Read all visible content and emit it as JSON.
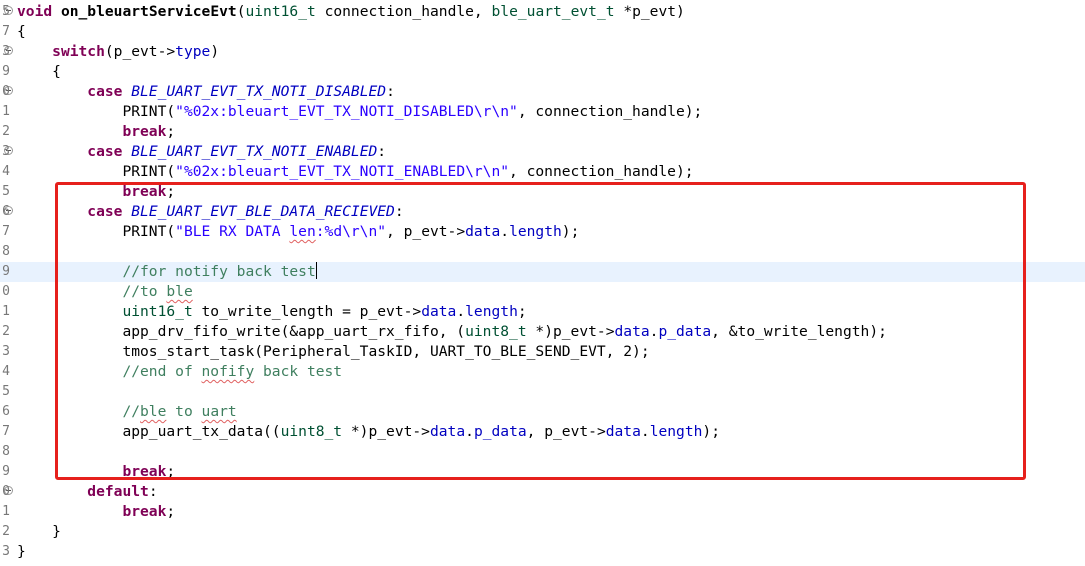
{
  "gutter_numbers": [
    "5",
    "7",
    "3",
    "9",
    "0",
    "1",
    "2",
    "3",
    "4",
    "5",
    "6",
    "7",
    "8",
    "9",
    "0",
    "1",
    "2",
    "3",
    "4",
    "5",
    "6",
    "7",
    "8",
    "9",
    "0",
    "1",
    "2",
    "3"
  ],
  "code": {
    "l0": {
      "kw": "void",
      "fn": "on_bleuartServiceEvt",
      "p1": "(",
      "t1": "uint16_t",
      "p2": " connection_handle, ",
      "t2": "ble_uart_evt_t",
      "p3": " *p_evt)"
    },
    "l1": {
      "text": "{"
    },
    "l2": {
      "kw": "switch",
      "p1": "(p_evt->",
      "fld": "type",
      "p2": ")"
    },
    "l3": {
      "text": "{"
    },
    "l4": {
      "kw": "case",
      "en": "BLE_UART_EVT_TX_NOTI_DISABLED",
      "p": ":"
    },
    "l5": {
      "p1": "PRINT(",
      "str": "\"%02x:bleuart_EVT_TX_NOTI_DISABLED\\r\\n\"",
      "p2": ", connection_handle);"
    },
    "l6": {
      "kw": "break",
      "p": ";"
    },
    "l7": {
      "kw": "case",
      "en": "BLE_UART_EVT_TX_NOTI_ENABLED",
      "p": ":"
    },
    "l8": {
      "p1": "PRINT(",
      "str": "\"%02x:bleuart_EVT_TX_NOTI_ENABLED\\r\\n\"",
      "p2": ", connection_handle);"
    },
    "l9": {
      "kw": "break",
      "p": ";"
    },
    "l10": {
      "kw": "case",
      "en": "BLE_UART_EVT_BLE_DATA_RECIEVED",
      "p": ":"
    },
    "l11": {
      "p1": "PRINT(",
      "s1": "\"BLE RX DATA ",
      "s2": "len",
      "s3": ":%d\\r\\n\"",
      "p2": ", p_evt->",
      "f1": "data",
      "p3": ".",
      "f2": "length",
      "p4": ");"
    },
    "l12": {
      "text": ""
    },
    "l13": {
      "cm": "//for notify back test"
    },
    "l14": {
      "c1": "//to ",
      "c2": "ble"
    },
    "l15": {
      "t": "uint16_t",
      "p1": " to_write_length = p_evt->",
      "f1": "data",
      "p2": ".",
      "f2": "length",
      "p3": ";"
    },
    "l16": {
      "p1": "app_drv_fifo_write(&app_uart_rx_fifo, (",
      "t": "uint8_t",
      "p2": " *)p_evt->",
      "f1": "data",
      "p3": ".",
      "f2": "p_data",
      "p4": ", &to_write_length);"
    },
    "l17": {
      "text": "tmos_start_task(Peripheral_TaskID, UART_TO_BLE_SEND_EVT, 2);"
    },
    "l18": {
      "c1": "//end of ",
      "c2": "nofify",
      "c3": " back test"
    },
    "l19": {
      "text": ""
    },
    "l20": {
      "c1": "//",
      "c2": "ble",
      "c3": " to ",
      "c4": "uart"
    },
    "l21": {
      "p1": "app_uart_tx_data((",
      "t": "uint8_t",
      "p2": " *)p_evt->",
      "f1": "data",
      "p3": ".",
      "f2": "p_data",
      "p4": ", p_evt->",
      "f3": "data",
      "p5": ".",
      "f4": "length",
      "p6": ");"
    },
    "l22": {
      "text": ""
    },
    "l23": {
      "kw": "break",
      "p": ";"
    },
    "l24": {
      "kw": "default",
      "p": ":"
    },
    "l25": {
      "kw": "break",
      "p": ";"
    },
    "l26": {
      "text": "}"
    },
    "l27": {
      "text": "}"
    }
  },
  "colors": {
    "keyword": "#7f0055",
    "type": "#005032",
    "enum_constant": "#0000c0",
    "string": "#2a00ff",
    "comment": "#3f7f5f",
    "field": "#0000c0",
    "current_line": "#e8f2fe",
    "highlight_box": "#e6201c"
  }
}
